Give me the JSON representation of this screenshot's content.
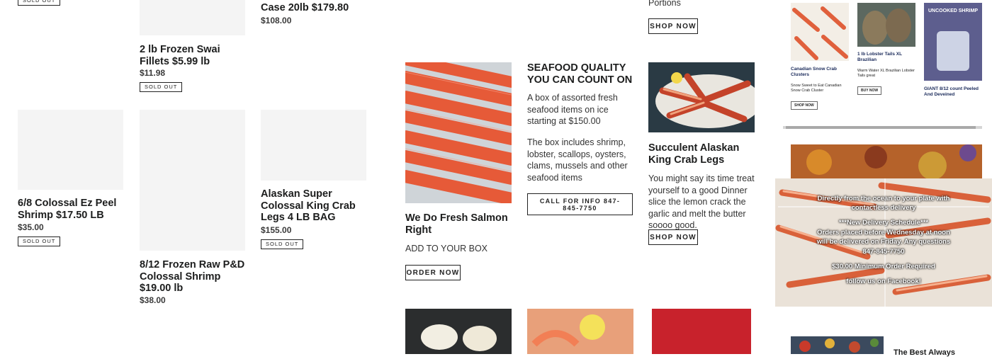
{
  "grid": {
    "products": [
      {
        "title": "2 lb Frozen Swai Fillets $5.99 lb",
        "price": "$11.98",
        "badge": "SOLD OUT"
      },
      {
        "title": "Case 20lb $179.80",
        "price": "$108.00"
      },
      {
        "title": "6/8 Colossal Ez Peel Shrimp $17.50 LB",
        "price": "$35.00",
        "badge": "SOLD OUT"
      },
      {
        "title": "8/12 Frozen Raw P&D Colossal Shrimp $19.00 lb",
        "price": "$38.00"
      },
      {
        "title": "Alaskan Super Colossal King Crab Legs 4 LB BAG",
        "price": "$155.00",
        "badge": "SOLD OUT"
      }
    ],
    "top_left_badge": "SOLD OUT"
  },
  "features": {
    "top_text": "Portions",
    "top_button": "SHOP NOW",
    "salmon": {
      "title": "We Do Fresh Salmon Right",
      "text": "ADD TO YOUR BOX",
      "button": "ORDER NOW"
    },
    "quality": {
      "title": "SEAFOOD QUALITY YOU CAN COUNT ON",
      "p1": "A box of assorted fresh seafood items on ice starting at $150.00",
      "p2": "The box includes shrimp, lobster, scallops, oysters, clams, mussels and other seafood items",
      "button": "CALL FOR INFO 847-845-7750"
    },
    "crab": {
      "title": "Succulent Alaskan King Crab Legs",
      "text": "You might say its time treat yourself to a good Dinner slice the lemon crack the garlic and melt the butter  soooo good.",
      "button": "SHOP NOW"
    }
  },
  "sidebar": {
    "slider": [
      {
        "title": "Canadian Snow Crab Clusters",
        "desc": "Snow Sweet to Eat Canadian Snow Crab Cluster",
        "button": "SHOP NOW"
      },
      {
        "title": "1 lb Lobster Tails XL Brazilian",
        "desc": "Warm Water XL Brazilian Lobster Tails great",
        "button": "BUY NOW"
      },
      {
        "title": "GIANT 8/12 count Peeled And Deveined",
        "package_label": "UNCOOKED SHRIMP"
      }
    ],
    "overlay": {
      "l1": "Directly from the ocean to your plate with contactless delivery",
      "l2": "***New Delivery Schedule***",
      "l3": "Orders placed before Wednesday at noon will be delivered on Friday. Any questions",
      "l4": "847-845-7750",
      "l5": "$30.00 Minimum Order Required",
      "l6": "follow us on Facebook!"
    },
    "bottom_title": "The Best Always"
  },
  "colors": {
    "text": "#1c1d1d",
    "salmon": "#e0573a",
    "crab": "#c1442a"
  }
}
